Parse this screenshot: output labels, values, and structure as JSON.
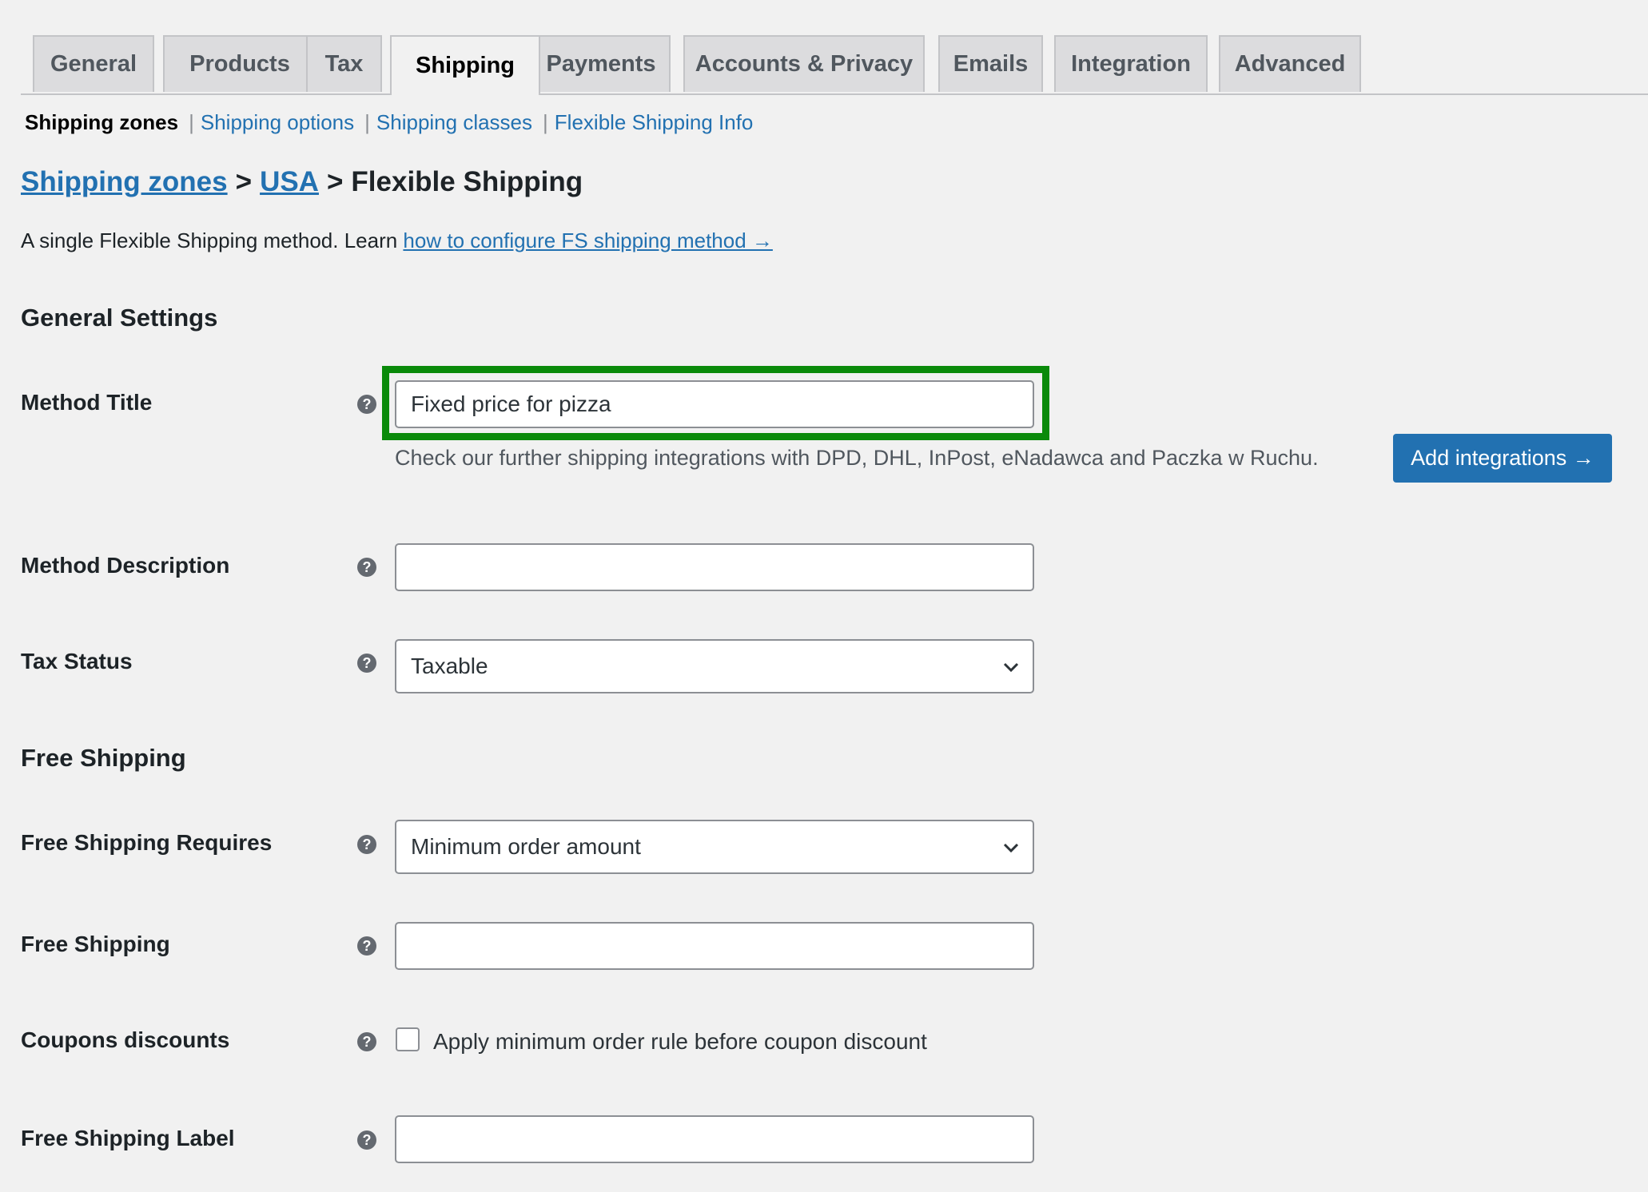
{
  "tabs": [
    {
      "label": "General"
    },
    {
      "label": "Products"
    },
    {
      "label": "Tax"
    },
    {
      "label": "Shipping",
      "active": true
    },
    {
      "label": "Payments"
    },
    {
      "label": "Accounts & Privacy"
    },
    {
      "label": "Emails"
    },
    {
      "label": "Integration"
    },
    {
      "label": "Advanced"
    }
  ],
  "subnav": {
    "current": "Shipping zones",
    "sep": "|",
    "links": [
      "Shipping options",
      "Shipping classes",
      "Flexible Shipping Info"
    ]
  },
  "breadcrumb": {
    "zones": "Shipping zones",
    "sep": ">",
    "zone": "USA",
    "method": "Flexible Shipping"
  },
  "intro": {
    "text": "A single Flexible Shipping method. Learn ",
    "link": "how to configure FS shipping method →"
  },
  "sections": {
    "general": "General Settings",
    "free": "Free Shipping"
  },
  "help_glyph": "?",
  "fields": {
    "method_title": {
      "label": "Method Title",
      "value": "Fixed price for pizza"
    },
    "method_title_desc": "Check our further shipping integrations with DPD, DHL, InPost, eNadawca and Paczka w Ruchu.",
    "add_integrations": "Add integrations →",
    "method_description": {
      "label": "Method Description",
      "value": ""
    },
    "tax_status": {
      "label": "Tax Status",
      "value": "Taxable"
    },
    "free_shipping_requires": {
      "label": "Free Shipping Requires",
      "value": "Minimum order amount"
    },
    "free_shipping": {
      "label": "Free Shipping",
      "value": ""
    },
    "coupons": {
      "label": "Coupons discounts",
      "checkbox_label": "Apply minimum order rule before coupon discount",
      "checked": false
    },
    "free_shipping_label": {
      "label": "Free Shipping Label",
      "value": ""
    }
  },
  "colors": {
    "link": "#2271b1",
    "button": "#2271b1",
    "highlight": "#0a8a0a"
  }
}
